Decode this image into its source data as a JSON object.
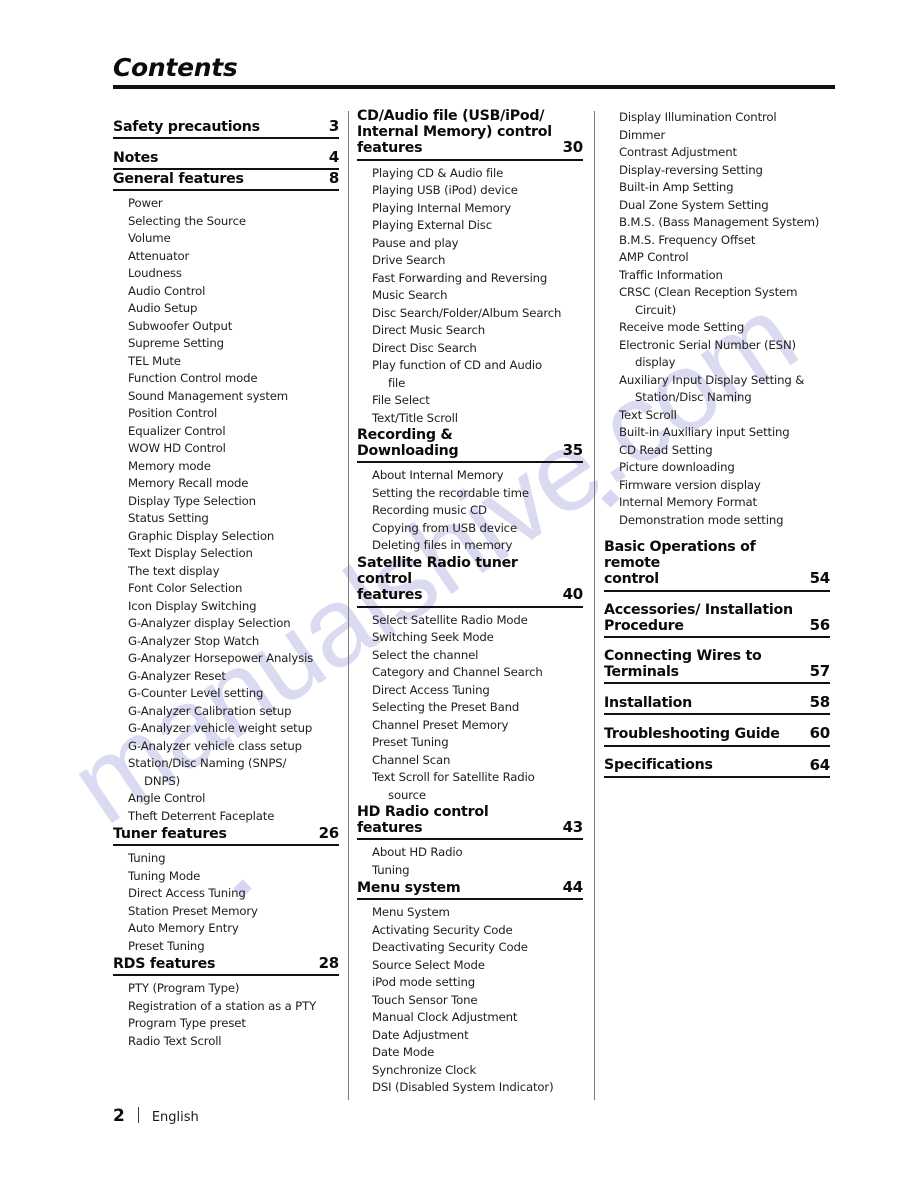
{
  "document": {
    "title": "Contents",
    "footer": {
      "page_number": "2",
      "language": "English"
    },
    "watermark": "manualshive.com"
  },
  "columns": [
    {
      "id": "column-1",
      "sections": [
        {
          "title": "Safety precautions",
          "page": "3",
          "entries": []
        },
        {
          "title": "Notes",
          "page": "4",
          "entries": []
        },
        {
          "title": "General features",
          "page": "8",
          "entries": [
            "Power",
            "Selecting the Source",
            "Volume",
            "Attenuator",
            "Loudness",
            "Audio Control",
            "Audio Setup",
            "Subwoofer Output",
            "Supreme Setting",
            "TEL Mute",
            "Function Control mode",
            "Sound Management system",
            "Position Control",
            "Equalizer Control",
            "WOW HD Control",
            "Memory mode",
            "Memory Recall mode",
            "Display Type Selection",
            "Status Setting",
            "Graphic Display Selection",
            "Text Display Selection",
            "The text display",
            "Font Color Selection",
            "Icon Display Switching",
            "G-Analyzer display Selection",
            "G-Analyzer Stop Watch",
            "G-Analyzer Horsepower Analysis",
            "G-Analyzer Reset",
            "G-Counter Level setting",
            "G-Analyzer Calibration setup",
            "G-Analyzer vehicle weight setup",
            "G-Analyzer vehicle class setup",
            "Station/Disc Naming (SNPS/\nDNPS)",
            "Angle Control",
            "Theft Deterrent Faceplate"
          ]
        },
        {
          "title": "Tuner features",
          "page": "26",
          "entries": [
            "Tuning",
            "Tuning Mode",
            "Direct Access Tuning",
            "Station Preset Memory",
            "Auto Memory Entry",
            "Preset Tuning"
          ]
        },
        {
          "title": "RDS features",
          "page": "28",
          "entries": [
            "PTY (Program Type)",
            "Registration of a station as a PTY",
            "Program Type preset",
            "Radio Text Scroll"
          ]
        }
      ]
    },
    {
      "id": "column-2",
      "sections": [
        {
          "title": "CD/Audio file (USB/iPod/\nInternal Memory) control\nfeatures",
          "page": "30",
          "entries": [
            "Playing CD & Audio file",
            "Playing USB (iPod) device",
            "Playing Internal Memory",
            "Playing External Disc",
            "Pause and play",
            "Drive Search",
            "Fast Forwarding and Reversing",
            "Music Search",
            "Disc Search/Folder/Album Search",
            "Direct Music Search",
            "Direct Disc Search",
            "Play function of CD and Audio\nfile",
            "File Select",
            "Text/Title Scroll"
          ]
        },
        {
          "title": "Recording & Downloading",
          "page": "35",
          "entries": [
            "About Internal Memory",
            "Setting the recordable time",
            "Recording music CD",
            "Copying from USB device",
            "Deleting files in memory"
          ]
        },
        {
          "title": "Satellite Radio tuner control\nfeatures",
          "page": "40",
          "entries": [
            "Select Satellite Radio Mode",
            "Switching Seek Mode",
            "Select the channel",
            "Category and Channel Search",
            "Direct Access Tuning",
            "Selecting the Preset Band",
            "Channel Preset Memory",
            "Preset Tuning",
            "Channel Scan",
            "Text Scroll for Satellite Radio\nsource"
          ]
        },
        {
          "title": "HD Radio control features",
          "page": "43",
          "entries": [
            "About HD Radio",
            "Tuning"
          ]
        },
        {
          "title": "Menu system",
          "page": "44",
          "entries": [
            "Menu System",
            "Activating Security Code",
            "Deactivating Security Code",
            "Source Select Mode",
            "iPod mode setting",
            "Touch Sensor Tone",
            "Manual Clock Adjustment",
            "Date Adjustment",
            "Date Mode",
            "Synchronize Clock",
            "DSI (Disabled System Indicator)"
          ]
        }
      ]
    },
    {
      "id": "column-3",
      "continued_entries": [
        "Display Illumination Control",
        "Dimmer",
        "Contrast Adjustment",
        "Display-reversing Setting",
        "Built-in Amp Setting",
        "Dual Zone System Setting",
        "B.M.S. (Bass Management System)",
        "B.M.S. Frequency Offset",
        "AMP Control",
        "Traffic Information",
        "CRSC (Clean Reception System\nCircuit)",
        "Receive mode Setting",
        "Electronic Serial Number (ESN)\ndisplay",
        "Auxiliary Input Display Setting &\nStation/Disc Naming",
        "Text Scroll",
        "Built-in Auxiliary input Setting",
        "CD Read Setting",
        "Picture downloading",
        "Firmware version display",
        "Internal Memory Format",
        "Demonstration mode setting"
      ],
      "sections": [
        {
          "title": "Basic Operations of remote\ncontrol",
          "page": "54",
          "entries": []
        },
        {
          "title": "Accessories/ Installation\nProcedure",
          "page": "56",
          "entries": []
        },
        {
          "title": "Connecting Wires to\nTerminals",
          "page": "57",
          "entries": []
        },
        {
          "title": "Installation",
          "page": "58",
          "entries": []
        },
        {
          "title": "Troubleshooting Guide",
          "page": "60",
          "entries": []
        },
        {
          "title": "Specifications",
          "page": "64",
          "entries": []
        }
      ]
    }
  ]
}
